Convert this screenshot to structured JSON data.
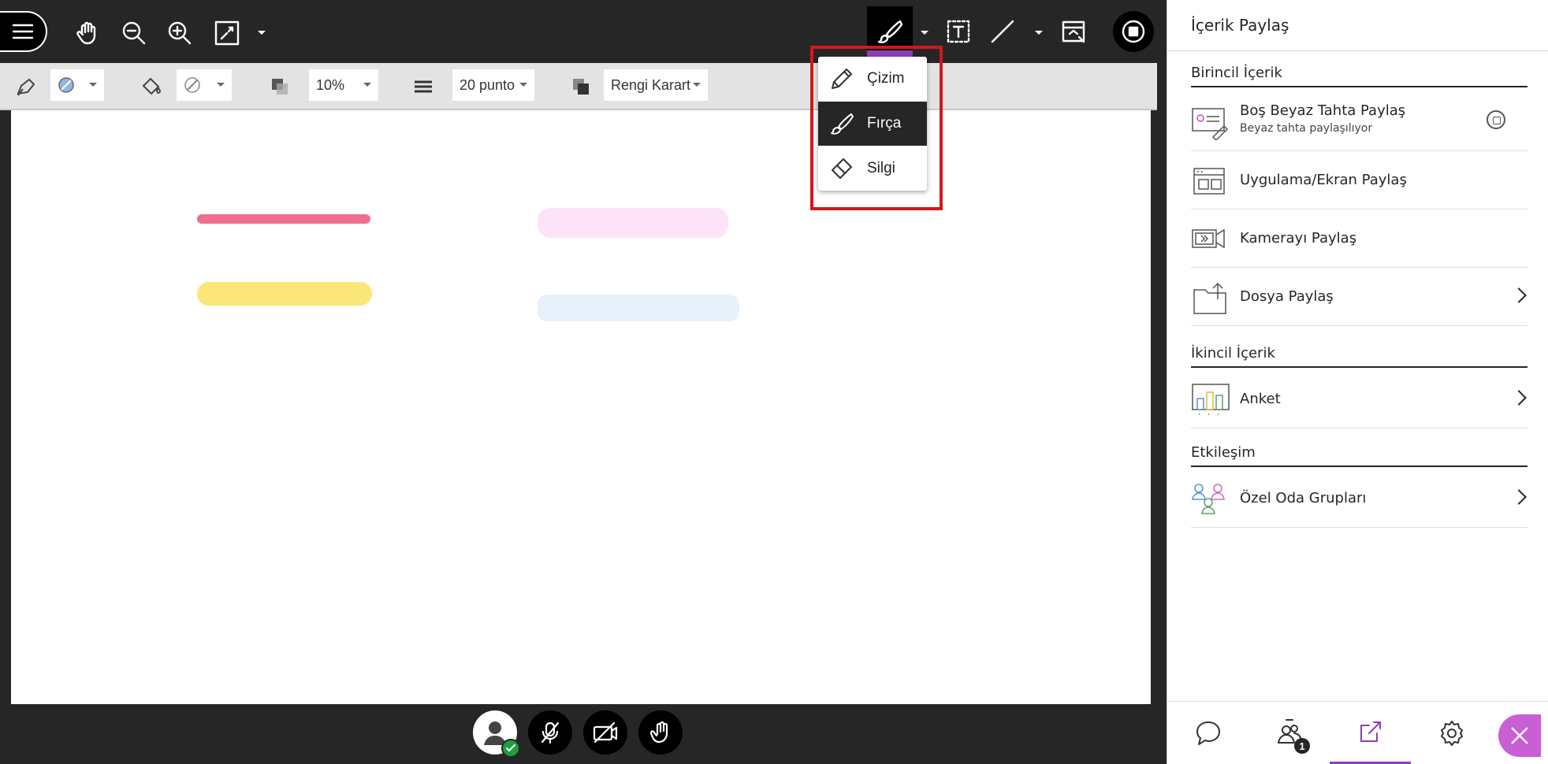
{
  "toolbar": {
    "icons": [
      "menu-icon",
      "hand-icon",
      "zoom-out-icon",
      "zoom-in-icon",
      "fit-screen-icon",
      "brush-icon",
      "text-tool-icon",
      "line-tool-icon",
      "image-tool-icon",
      "stop-sharing-icon"
    ],
    "active_tool_color": "#000000",
    "accent": "#8a3fb8"
  },
  "sub_toolbar": {
    "opacity_value": "10%",
    "size_value": "20 punto",
    "blend_value": "Rengi Karart"
  },
  "canvas": {
    "strokes": [
      {
        "color": "#f06f8c"
      },
      {
        "color": "#fbe67a"
      },
      {
        "color": "#fce3f8"
      },
      {
        "color": "#e7f1fc"
      }
    ]
  },
  "draw_menu": {
    "items": [
      {
        "label": "Çizim",
        "icon": "pencil-icon",
        "active": false
      },
      {
        "label": "Fırça",
        "icon": "brush-icon",
        "active": true
      },
      {
        "label": "Silgi",
        "icon": "eraser-icon",
        "active": false
      }
    ],
    "highlight_color": "#d4171e"
  },
  "panel": {
    "title": "İçerik Paylaş",
    "primary": {
      "heading": "Birincil İçerik",
      "items": [
        {
          "label": "Boş Beyaz Tahta Paylaş",
          "sub": "Beyaz tahta paylaşılıyor"
        },
        {
          "label": "Uygulama/Ekran Paylaş"
        },
        {
          "label": "Kamerayı Paylaş"
        },
        {
          "label": "Dosya Paylaş"
        }
      ]
    },
    "secondary": {
      "heading": "İkincil İçerik",
      "items": [
        {
          "label": "Anket"
        }
      ]
    },
    "interaction": {
      "heading": "Etkileşim",
      "items": [
        {
          "label": "Özel Oda Grupları"
        }
      ]
    },
    "tabs": {
      "participants_count": "1",
      "accent": "#8a3fb8",
      "close_color": "#c95ed7"
    }
  }
}
